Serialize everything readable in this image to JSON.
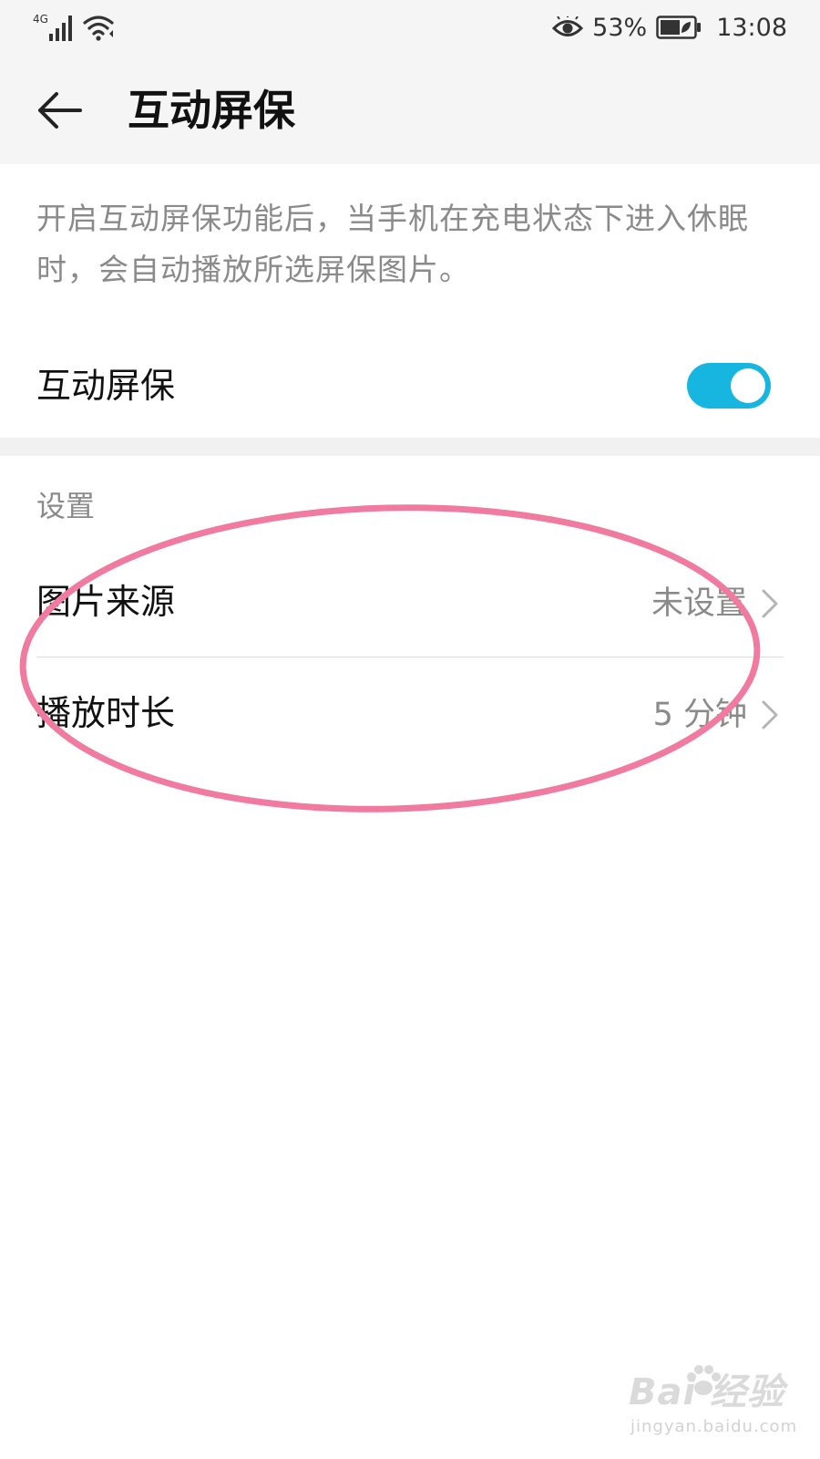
{
  "status_bar": {
    "network": "4G",
    "battery_percent": "53%",
    "time": "13:08",
    "icons": [
      "signal-icon",
      "wifi-icon",
      "eye-comfort-icon",
      "battery-icon"
    ]
  },
  "header": {
    "title": "互动屏保"
  },
  "description": "开启互动屏保功能后，当手机在充电状态下进入休眠时，会自动播放所选屏保图片。",
  "toggle": {
    "label": "互动屏保",
    "checked": true
  },
  "settings": {
    "section_title": "设置",
    "items": [
      {
        "label": "图片来源",
        "value": "未设置"
      },
      {
        "label": "播放时长",
        "value": "5 分钟"
      }
    ]
  },
  "watermark": {
    "logo_text": "Bai 经验",
    "url": "jingyan.baidu.com"
  },
  "colors": {
    "accent": "#16b6e0",
    "annotation": "#f07aa0",
    "header_bg": "#f5f5f5",
    "secondary_text": "#8a8a8a"
  }
}
